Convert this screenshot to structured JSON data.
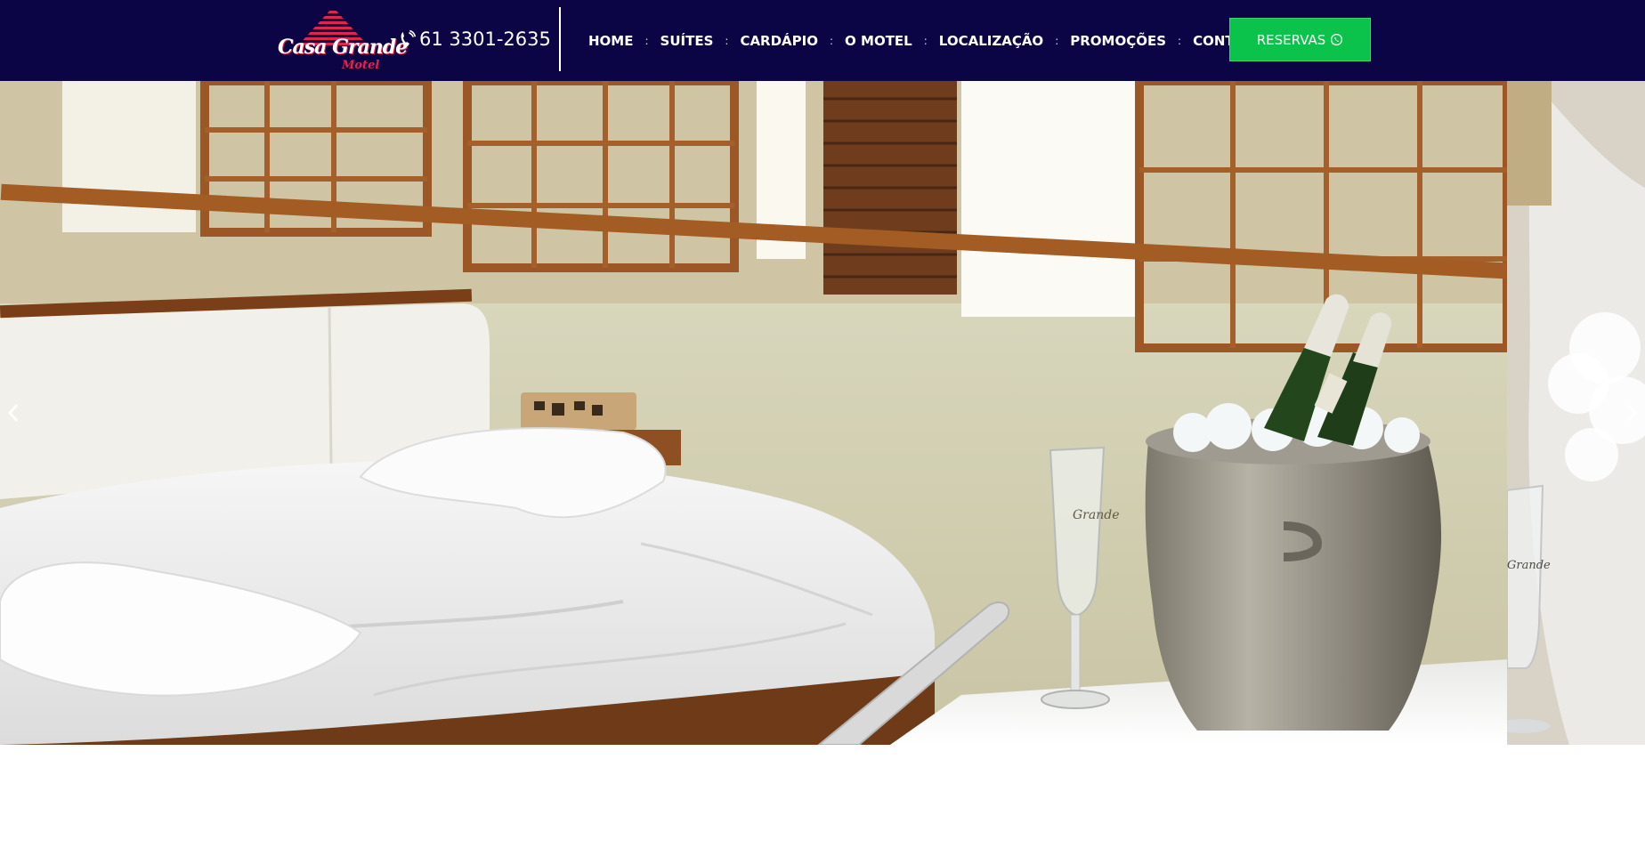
{
  "header": {
    "logo": {
      "title": "Casa Grande",
      "subtitle": "Motel"
    },
    "phone": {
      "icon": "phone-volume-icon",
      "number": "61 3301-2635"
    },
    "nav": [
      {
        "label": "HOME"
      },
      {
        "label": "SUÍTES"
      },
      {
        "label": "CARDÁPIO"
      },
      {
        "label": "O MOTEL"
      },
      {
        "label": "LOCALIZAÇÃO"
      },
      {
        "label": "PROMOÇÕES"
      },
      {
        "label": "CONTATO"
      }
    ],
    "reserve_button": {
      "label": "RESERVAS",
      "icon": "whatsapp-icon"
    }
  },
  "hero": {
    "slides": [
      {
        "subject": "suite-bed-champagne-photo"
      },
      {
        "subject": "champagne-glass-photo"
      }
    ],
    "prev_icon": "chevron-left-icon",
    "next_icon": "chevron-right-icon"
  },
  "colors": {
    "header_bg": "#0b0445",
    "accent_red": "#e3244d",
    "reserve_green": "#0bc24b",
    "text_white": "#ffffff"
  }
}
